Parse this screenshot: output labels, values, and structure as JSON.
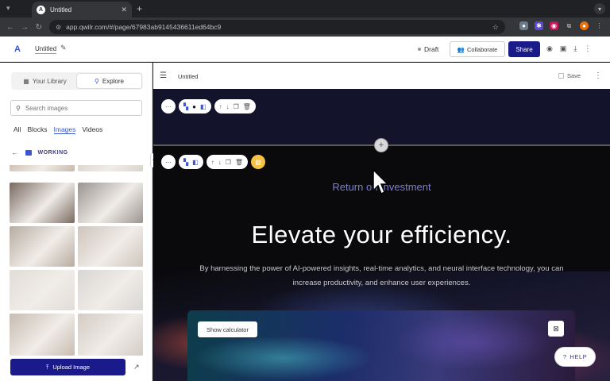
{
  "browser": {
    "tab_title": "Untitled",
    "tab_close": "✕",
    "new_tab": "+",
    "url": "app.qwilr.com/#/page/67983ab9145436611ed64bc9"
  },
  "app_header": {
    "doc_title": "Untitled",
    "status": "Draft",
    "collaborate_label": "Collaborate",
    "share_label": "Share"
  },
  "sidebar": {
    "tabs": [
      {
        "label": "Your Library",
        "icon": "grid-icon",
        "active": false
      },
      {
        "label": "Explore",
        "icon": "search-icon",
        "active": true
      }
    ],
    "search_placeholder": "Search images",
    "filters": [
      {
        "label": "All",
        "active": false
      },
      {
        "label": "Blocks",
        "active": false
      },
      {
        "label": "Images",
        "active": true
      },
      {
        "label": "Videos",
        "active": false
      }
    ],
    "folder_label": "WORKING",
    "upload_label": "Upload Image",
    "thumbnails": [
      {
        "desc": "people at desk",
        "color": "#c9b9a8"
      },
      {
        "desc": "hands with laptop",
        "color": "#d9d3cc"
      },
      {
        "desc": "two men working",
        "color": "#7a6a60"
      },
      {
        "desc": "people at laptop",
        "color": "#9a9490"
      },
      {
        "desc": "person on laptop",
        "color": "#b8aca0"
      },
      {
        "desc": "woman writing",
        "color": "#cfc5bc"
      },
      {
        "desc": "woman at desk",
        "color": "#e2ddd8"
      },
      {
        "desc": "woman at window",
        "color": "#d8d6d4"
      },
      {
        "desc": "laptop on table",
        "color": "#c8bcb0"
      },
      {
        "desc": "woman on bed",
        "color": "#d4ccc4"
      }
    ]
  },
  "editor": {
    "page_title": "Untitled",
    "save_label": "Save",
    "roi_text": "Return on Investment",
    "headline": "Elevate your efficiency.",
    "subtext": "By harnessing the power of AI-powered insights, real-time analytics, and neural interface technology, you can increase productivity, and enhance user experiences.",
    "show_calculator_label": "Show calculator"
  },
  "help_label": "HELP",
  "colors": {
    "primary": "#1a1a8a",
    "accent_blue": "#3a56d4",
    "roi_text": "#7b7fd0",
    "canvas_bg": "#0a0a0c"
  }
}
